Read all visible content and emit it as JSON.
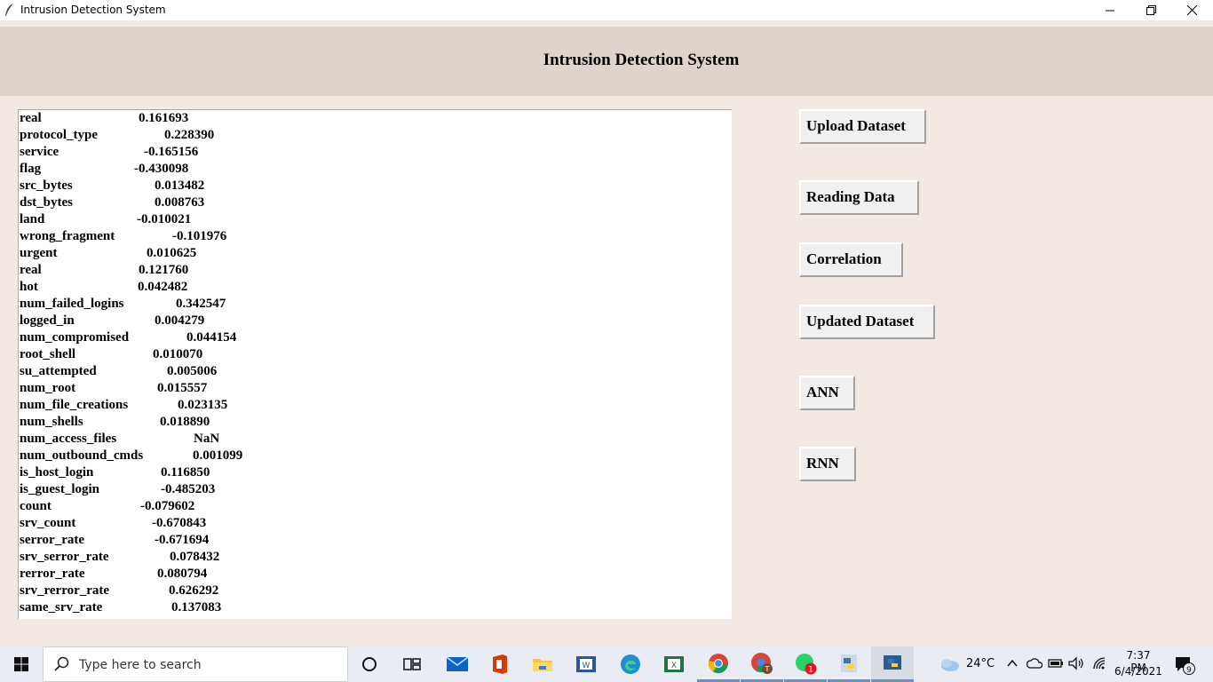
{
  "window": {
    "title": "Intrusion Detection System"
  },
  "header": {
    "title": "Intrusion Detection System"
  },
  "correlation": [
    {
      "key": "real",
      "value": "0.161693"
    },
    {
      "key": "protocol_type",
      "value": "0.228390"
    },
    {
      "key": "service",
      "value": "-0.165156"
    },
    {
      "key": "flag",
      "value": "-0.430098"
    },
    {
      "key": "src_bytes",
      "value": "0.013482"
    },
    {
      "key": "dst_bytes",
      "value": "0.008763"
    },
    {
      "key": "land",
      "value": "-0.010021"
    },
    {
      "key": "wrong_fragment",
      "value": "-0.101976"
    },
    {
      "key": "urgent",
      "value": "0.010625"
    },
    {
      "key": "real",
      "value": "0.121760"
    },
    {
      "key": "hot",
      "value": "0.042482"
    },
    {
      "key": "num_failed_logins",
      "value": "0.342547"
    },
    {
      "key": "logged_in",
      "value": "0.004279"
    },
    {
      "key": "num_compromised",
      "value": "0.044154"
    },
    {
      "key": "root_shell",
      "value": "0.010070"
    },
    {
      "key": "su_attempted",
      "value": "0.005006"
    },
    {
      "key": "num_root",
      "value": "0.015557"
    },
    {
      "key": "num_file_creations",
      "value": "0.023135"
    },
    {
      "key": "num_shells",
      "value": "0.018890"
    },
    {
      "key": "num_access_files",
      "value": "NaN"
    },
    {
      "key": "num_outbound_cmds",
      "value": "0.001099"
    },
    {
      "key": "is_host_login",
      "value": "0.116850"
    },
    {
      "key": "is_guest_login",
      "value": "-0.485203"
    },
    {
      "key": "count",
      "value": "-0.079602"
    },
    {
      "key": "srv_count",
      "value": "-0.670843"
    },
    {
      "key": "serror_rate",
      "value": "-0.671694"
    },
    {
      "key": "srv_serror_rate",
      "value": "0.078432"
    },
    {
      "key": "rerror_rate",
      "value": "0.080794"
    },
    {
      "key": "srv_rerror_rate",
      "value": "0.626292"
    },
    {
      "key": "same_srv_rate",
      "value": "0.137083"
    }
  ],
  "buttons": {
    "upload": "Upload Dataset",
    "reading": "Reading Data",
    "correlation": "Correlation",
    "updated": "Updated Dataset",
    "ann": "ANN",
    "rnn": "RNN"
  },
  "taskbar": {
    "search_placeholder": "Type here to search",
    "weather": "24°C",
    "time": "7:37 PM",
    "date": "6/4/2021",
    "whatsapp_badge": "1",
    "notifications": "9"
  },
  "colors": {
    "background": "#f2e8e4",
    "header": "#dfd3cd",
    "button": "#f0f0f0"
  }
}
